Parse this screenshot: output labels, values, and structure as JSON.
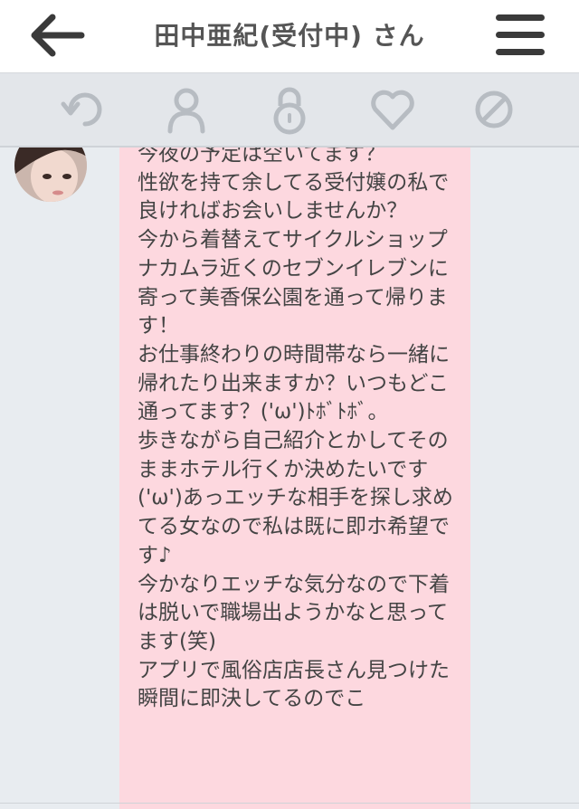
{
  "header": {
    "title": "田中亜紀(受付中) さん",
    "back_icon": "arrow-left-icon",
    "menu_icon": "hamburger-menu-icon"
  },
  "toolbar": {
    "icons": [
      "refresh-icon",
      "user-icon",
      "lock-icon",
      "heart-icon",
      "block-icon"
    ],
    "icon_color": "#b7bcc2"
  },
  "message": {
    "bubble_color": "#fdd8df",
    "text": "今夜の予定は空いてます？\n性欲を持て余してる受付嬢の私で良ければお会いしませんか？\n今から着替えてサイクルショップナカムラ近くのセブンイレブンに寄って美香保公園を通って帰ります！\nお仕事終わりの時間帯なら一緒に帰れたり出来ますか？いつもどこ通ってます？('ω')ﾄﾎﾞﾄﾎﾞ。\n歩きながら自己紹介とかしてそのままホテル行くか決めたいです('ω')あっエッチな相手を探し求めてる女なので私は既に即ホ希望です♪\n今かなりエッチな気分なので下着は脱いで職場出ようかなと思ってます(笑)\nアプリで風俗店店長さん見つけた瞬間に即決してるのでこ"
  }
}
